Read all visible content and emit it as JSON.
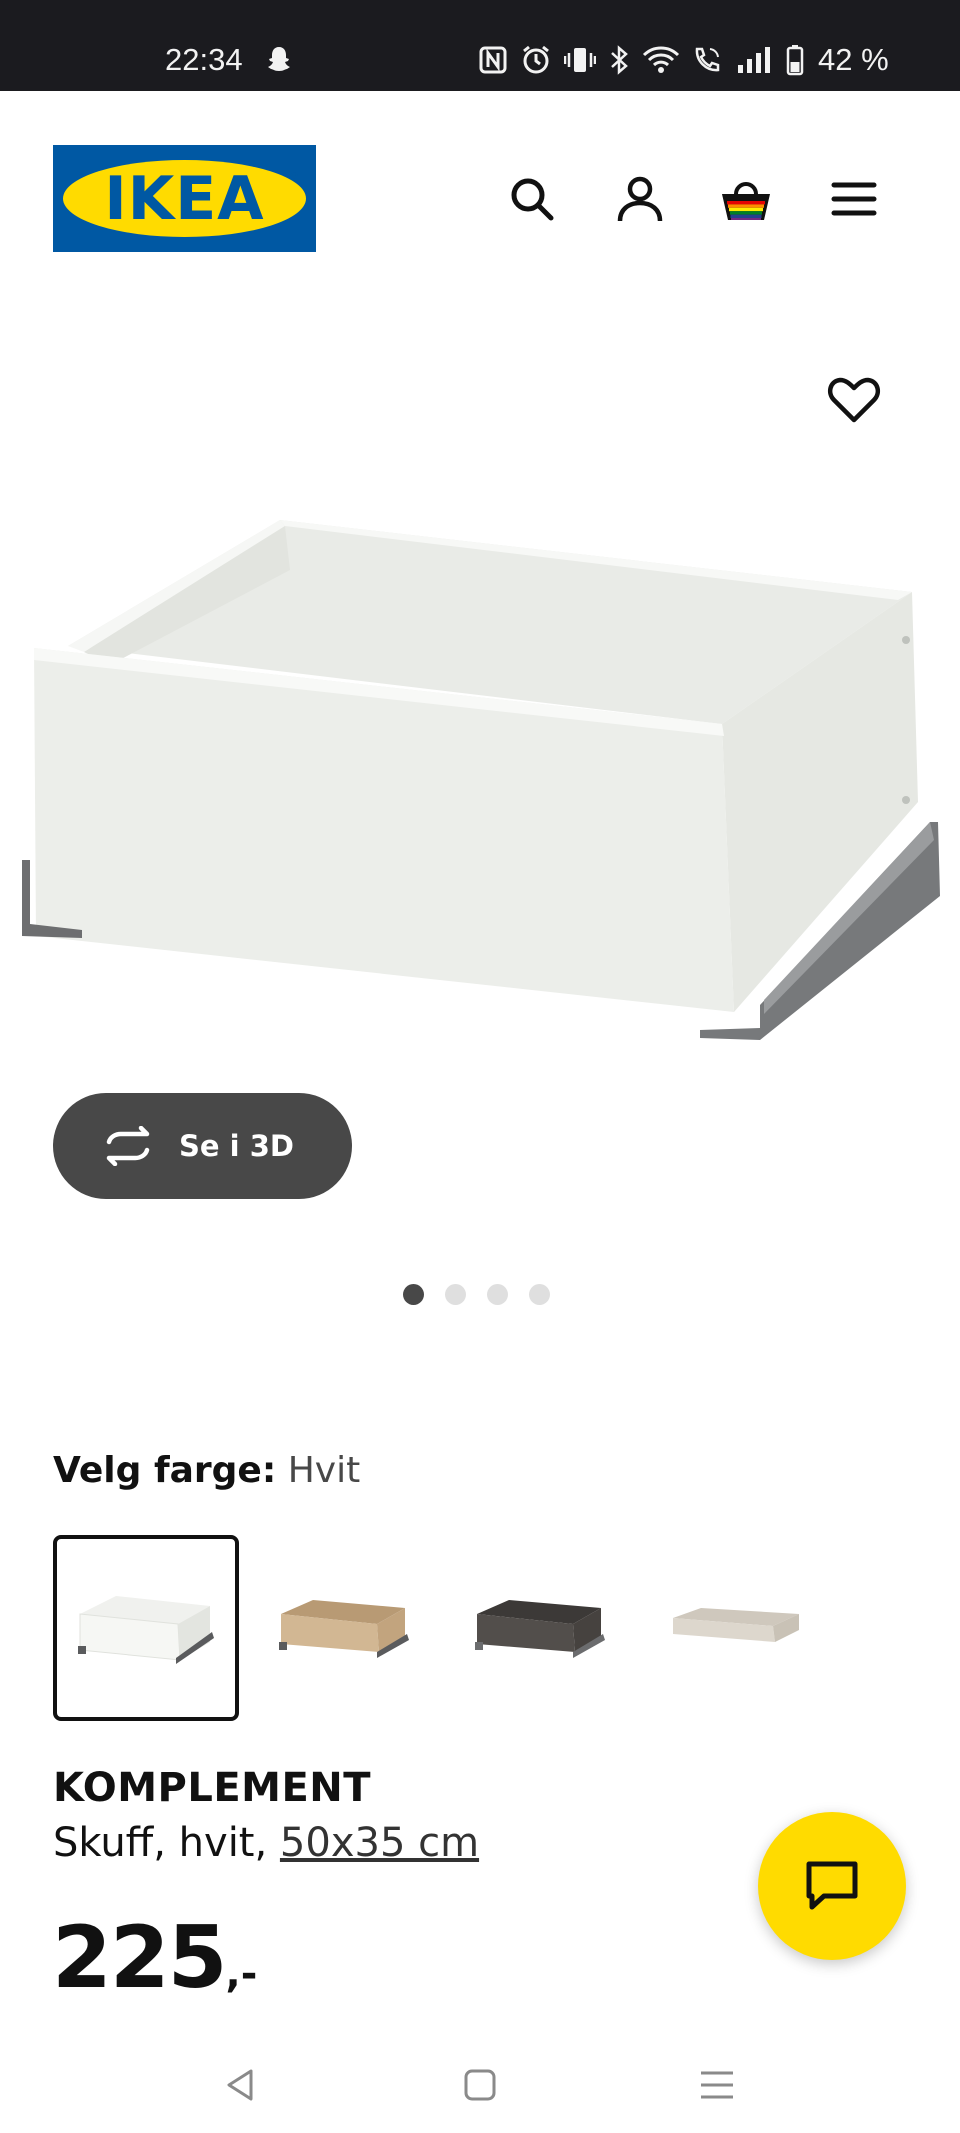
{
  "status_bar": {
    "time": "22:34",
    "battery": "42 %",
    "icons": [
      "snapchat-icon",
      "nfc-icon",
      "alarm-icon",
      "vibrate-icon",
      "bluetooth-icon",
      "wifi-icon",
      "volte-call-icon",
      "signal-icon",
      "battery-icon"
    ]
  },
  "header": {
    "logo_text": "IKEA",
    "logo_registered": "®",
    "brand_colors": {
      "blue": "#0058a3",
      "yellow": "#ffdb00"
    },
    "icons": [
      "search-icon",
      "profile-icon",
      "cart-icon",
      "menu-icon"
    ]
  },
  "gallery": {
    "favorite_icon": "heart-icon",
    "view_3d_label": "Se i 3D",
    "view_3d_icon": "rotate-icon",
    "image_count": 4,
    "active_index": 0
  },
  "color_picker": {
    "label": "Velg farge:",
    "selected": "Hvit",
    "swatches": [
      {
        "name": "hvit",
        "color": "#f3f3f1",
        "selected": true
      },
      {
        "name": "eik",
        "color": "#cdb28e",
        "selected": false
      },
      {
        "name": "mørk grå",
        "color": "#4d4946",
        "selected": false
      },
      {
        "name": "beige",
        "color": "#d8d2c8",
        "selected": false
      }
    ]
  },
  "product": {
    "name": "KOMPLEMENT",
    "description": "Skuff, hvit, ",
    "dimension_link": "50x35 cm",
    "price": "225",
    "price_suffix": ",-"
  },
  "chat_button": {
    "icon": "chat-icon"
  },
  "system_nav": {
    "icons": [
      "back-icon",
      "home-icon",
      "recents-icon"
    ]
  }
}
